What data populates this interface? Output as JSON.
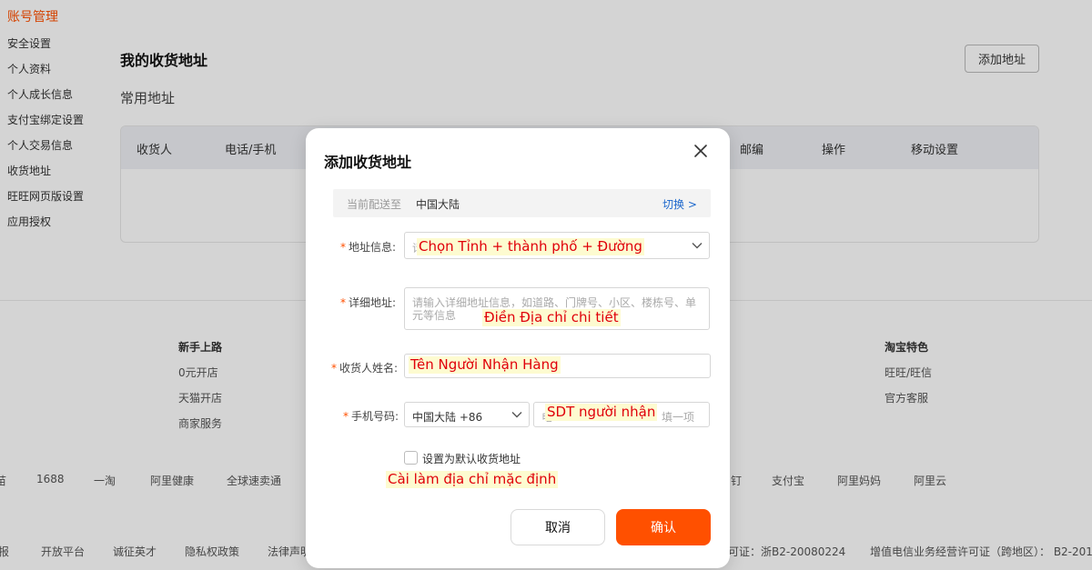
{
  "sidebar": {
    "title": "账号管理",
    "items": [
      "安全设置",
      "个人资料",
      "个人成长信息",
      "支付宝绑定设置",
      "个人交易信息",
      "收货地址",
      "旺旺网页版设置",
      "应用授权"
    ]
  },
  "main": {
    "title": "我的收货地址",
    "add_button": "添加地址",
    "common_title": "常用地址",
    "table_headers": [
      "收货人",
      "电话/手机",
      "邮编",
      "操作",
      "移动设置"
    ]
  },
  "footer": {
    "col1_title": "新手上路",
    "col1_items": [
      "0元开店",
      "天猫开店",
      "商家服务"
    ],
    "col2_title": "淘宝特色",
    "col2_items": [
      "旺旺/旺信",
      "官方客服"
    ],
    "links_left": [
      "苗",
      "1688",
      "一淘",
      "阿里健康",
      "全球速卖通"
    ],
    "links_right": [
      "钉",
      "支付宝",
      "阿里妈妈",
      "阿里云"
    ],
    "bottom_left": [
      "报",
      "开放平台",
      "诚征英才",
      "隐私权政策",
      "法律声明"
    ],
    "bottom_right": [
      "可证：浙B2-20080224",
      "增值电信业务经营许可证（跨地区）： B2-201"
    ]
  },
  "modal": {
    "title": "添加收货地址",
    "delivery": {
      "label": "当前配送至",
      "value": "中国大陆",
      "switch": "切换 >"
    },
    "address_info": {
      "label": "地址信息:",
      "placeholder": "请",
      "annotation": "Chọn Tỉnh + thành phố + Đường"
    },
    "detail_address": {
      "label": "详细地址:",
      "placeholder_line1": "请输入详细地址信息，如道路、门牌号、小区、楼栋号、单",
      "placeholder_line2": "元等信息",
      "annotation": "Điền Địa chỉ chi tiết"
    },
    "receiver_name": {
      "label": "收货人姓名:",
      "annotation": "Tên Người Nhận Hàng"
    },
    "phone": {
      "label": "手机号码:",
      "region": "中国大陆 +86",
      "placeholder_start": "电",
      "placeholder_end": "填一项",
      "annotation": "SDT người nhận"
    },
    "default_checkbox": {
      "label": "设置为默认收货地址",
      "annotation": "Cài làm địa chỉ mặc định"
    },
    "cancel": "取消",
    "confirm": "确认"
  }
}
